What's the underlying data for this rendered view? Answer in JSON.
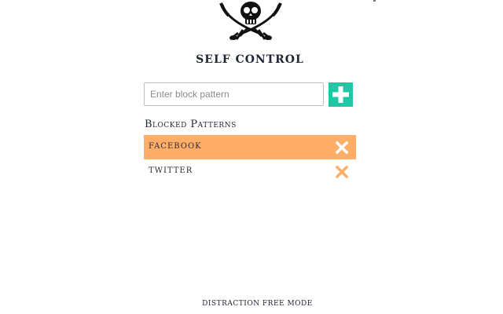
{
  "app": {
    "title": "SELF CONTROL",
    "logo_icon": "pirate-skull-crossed-swords-icon"
  },
  "add_pattern": {
    "placeholder": "Enter block pattern",
    "value": "",
    "button_icon": "plus-icon",
    "button_color": "#1fc7a4"
  },
  "blocked": {
    "heading": "Blocked Patterns",
    "items": [
      {
        "label": "FACEBOOK",
        "highlighted": true,
        "remove_icon": "close-icon"
      },
      {
        "label": "TWITTER",
        "highlighted": false,
        "remove_icon": "close-icon"
      }
    ],
    "highlight_color": "#ffae6a",
    "remove_icon_color": "#ffae6a"
  },
  "footer": {
    "text": "DISTRACTION FREE MODE"
  }
}
